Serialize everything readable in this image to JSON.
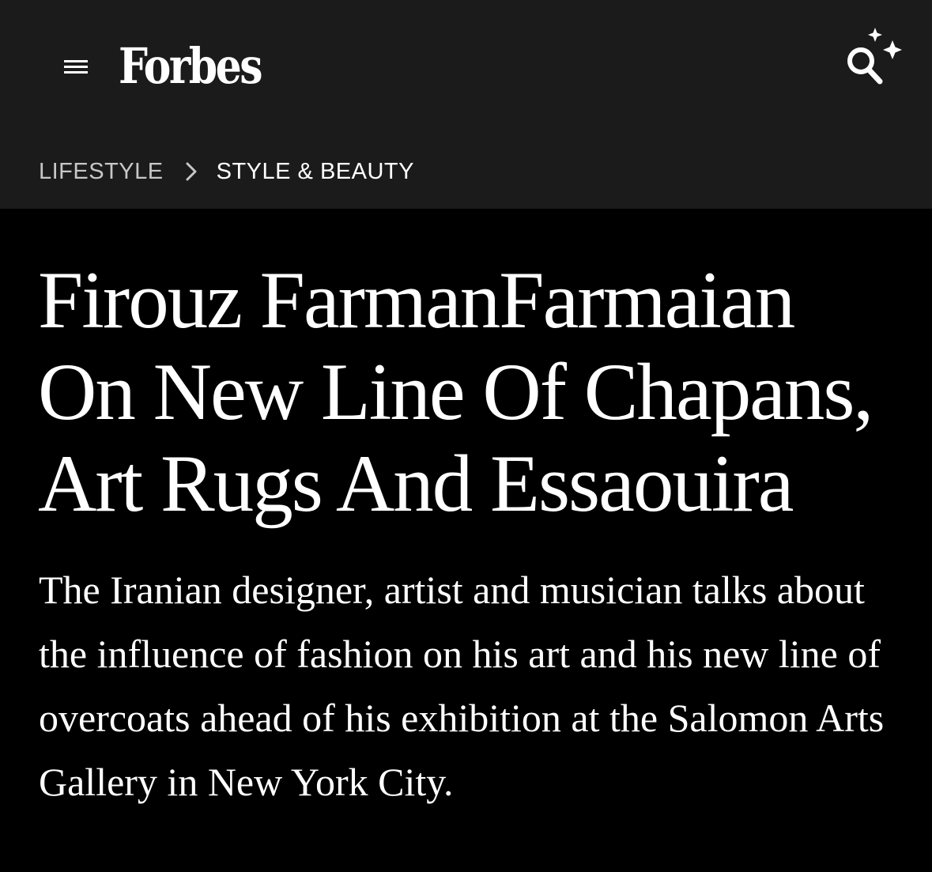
{
  "header": {
    "logo_text": "Forbes",
    "menu_icon": "hamburger-menu-icon",
    "search_icon": "ai-search-sparkle-icon",
    "background_color": "#1b1b1b"
  },
  "breadcrumb": {
    "parent": "LIFESTYLE",
    "separator_icon": "chevron-right-icon",
    "current": "STYLE & BEAUTY"
  },
  "article": {
    "headline_lines": [
      "Firouz FarmanFarmaian",
      "On New Line Of Chapans,",
      "Art Rugs And Essaouira"
    ],
    "dek": "The Iranian designer, artist and musician talks about the influence of fashion on his art and his new line of overcoats ahead of his exhibition at the Salomon Arts Gallery in New York City.",
    "background_color": "#000000"
  }
}
